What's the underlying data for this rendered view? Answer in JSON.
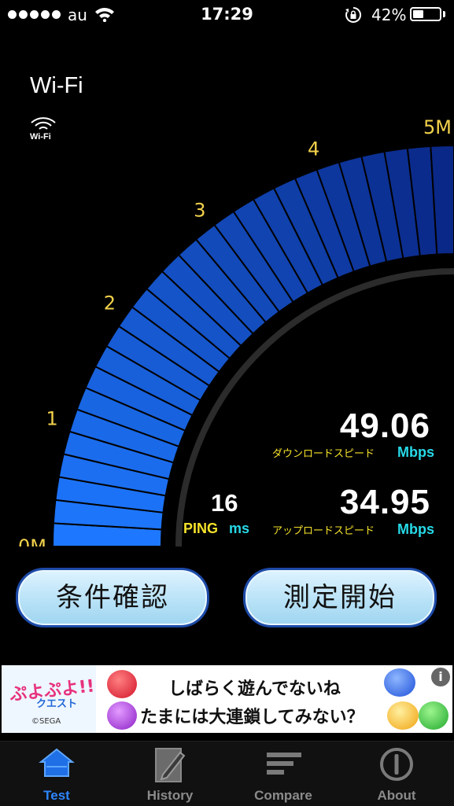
{
  "status_bar": {
    "carrier": "au",
    "time": "17:29",
    "battery_percent": "42%",
    "battery_level": 0.42,
    "signal_dots": 5
  },
  "connection": {
    "type_label": "Wi-Fi",
    "icon_label": "Wi-Fi",
    "icon": "wifi-icon"
  },
  "gauge": {
    "scale_labels": [
      "0M",
      "1",
      "2",
      "3",
      "4",
      "5M"
    ],
    "fill_fraction": 1.0,
    "colors": {
      "fill_dark": "#0a2a86",
      "fill_light": "#1e78ff",
      "tick": "#f2d14b"
    }
  },
  "results": {
    "download_value": "49.06",
    "download_label": "ダウンロードスピード",
    "download_unit": "Mbps",
    "upload_value": "34.95",
    "upload_label": "アップロードスピード",
    "upload_unit": "Mbps",
    "ping_value": "16",
    "ping_label": "PING",
    "ping_unit": "ms"
  },
  "buttons": {
    "conditions": "条件確認",
    "start": "測定開始"
  },
  "ad": {
    "logo_text": "ぷよぷよ!!",
    "logo_sub": "クエスト",
    "copyright": "©SEGA",
    "line1": "しばらく遊んでないね",
    "line2": "たまには大連鎖してみない？",
    "info_icon": "info-icon"
  },
  "tabs": [
    {
      "label": "Test",
      "icon": "home-icon",
      "active": true
    },
    {
      "label": "History",
      "icon": "history-icon",
      "active": false
    },
    {
      "label": "Compare",
      "icon": "compare-icon",
      "active": false
    },
    {
      "label": "About",
      "icon": "about-icon",
      "active": false
    }
  ]
}
